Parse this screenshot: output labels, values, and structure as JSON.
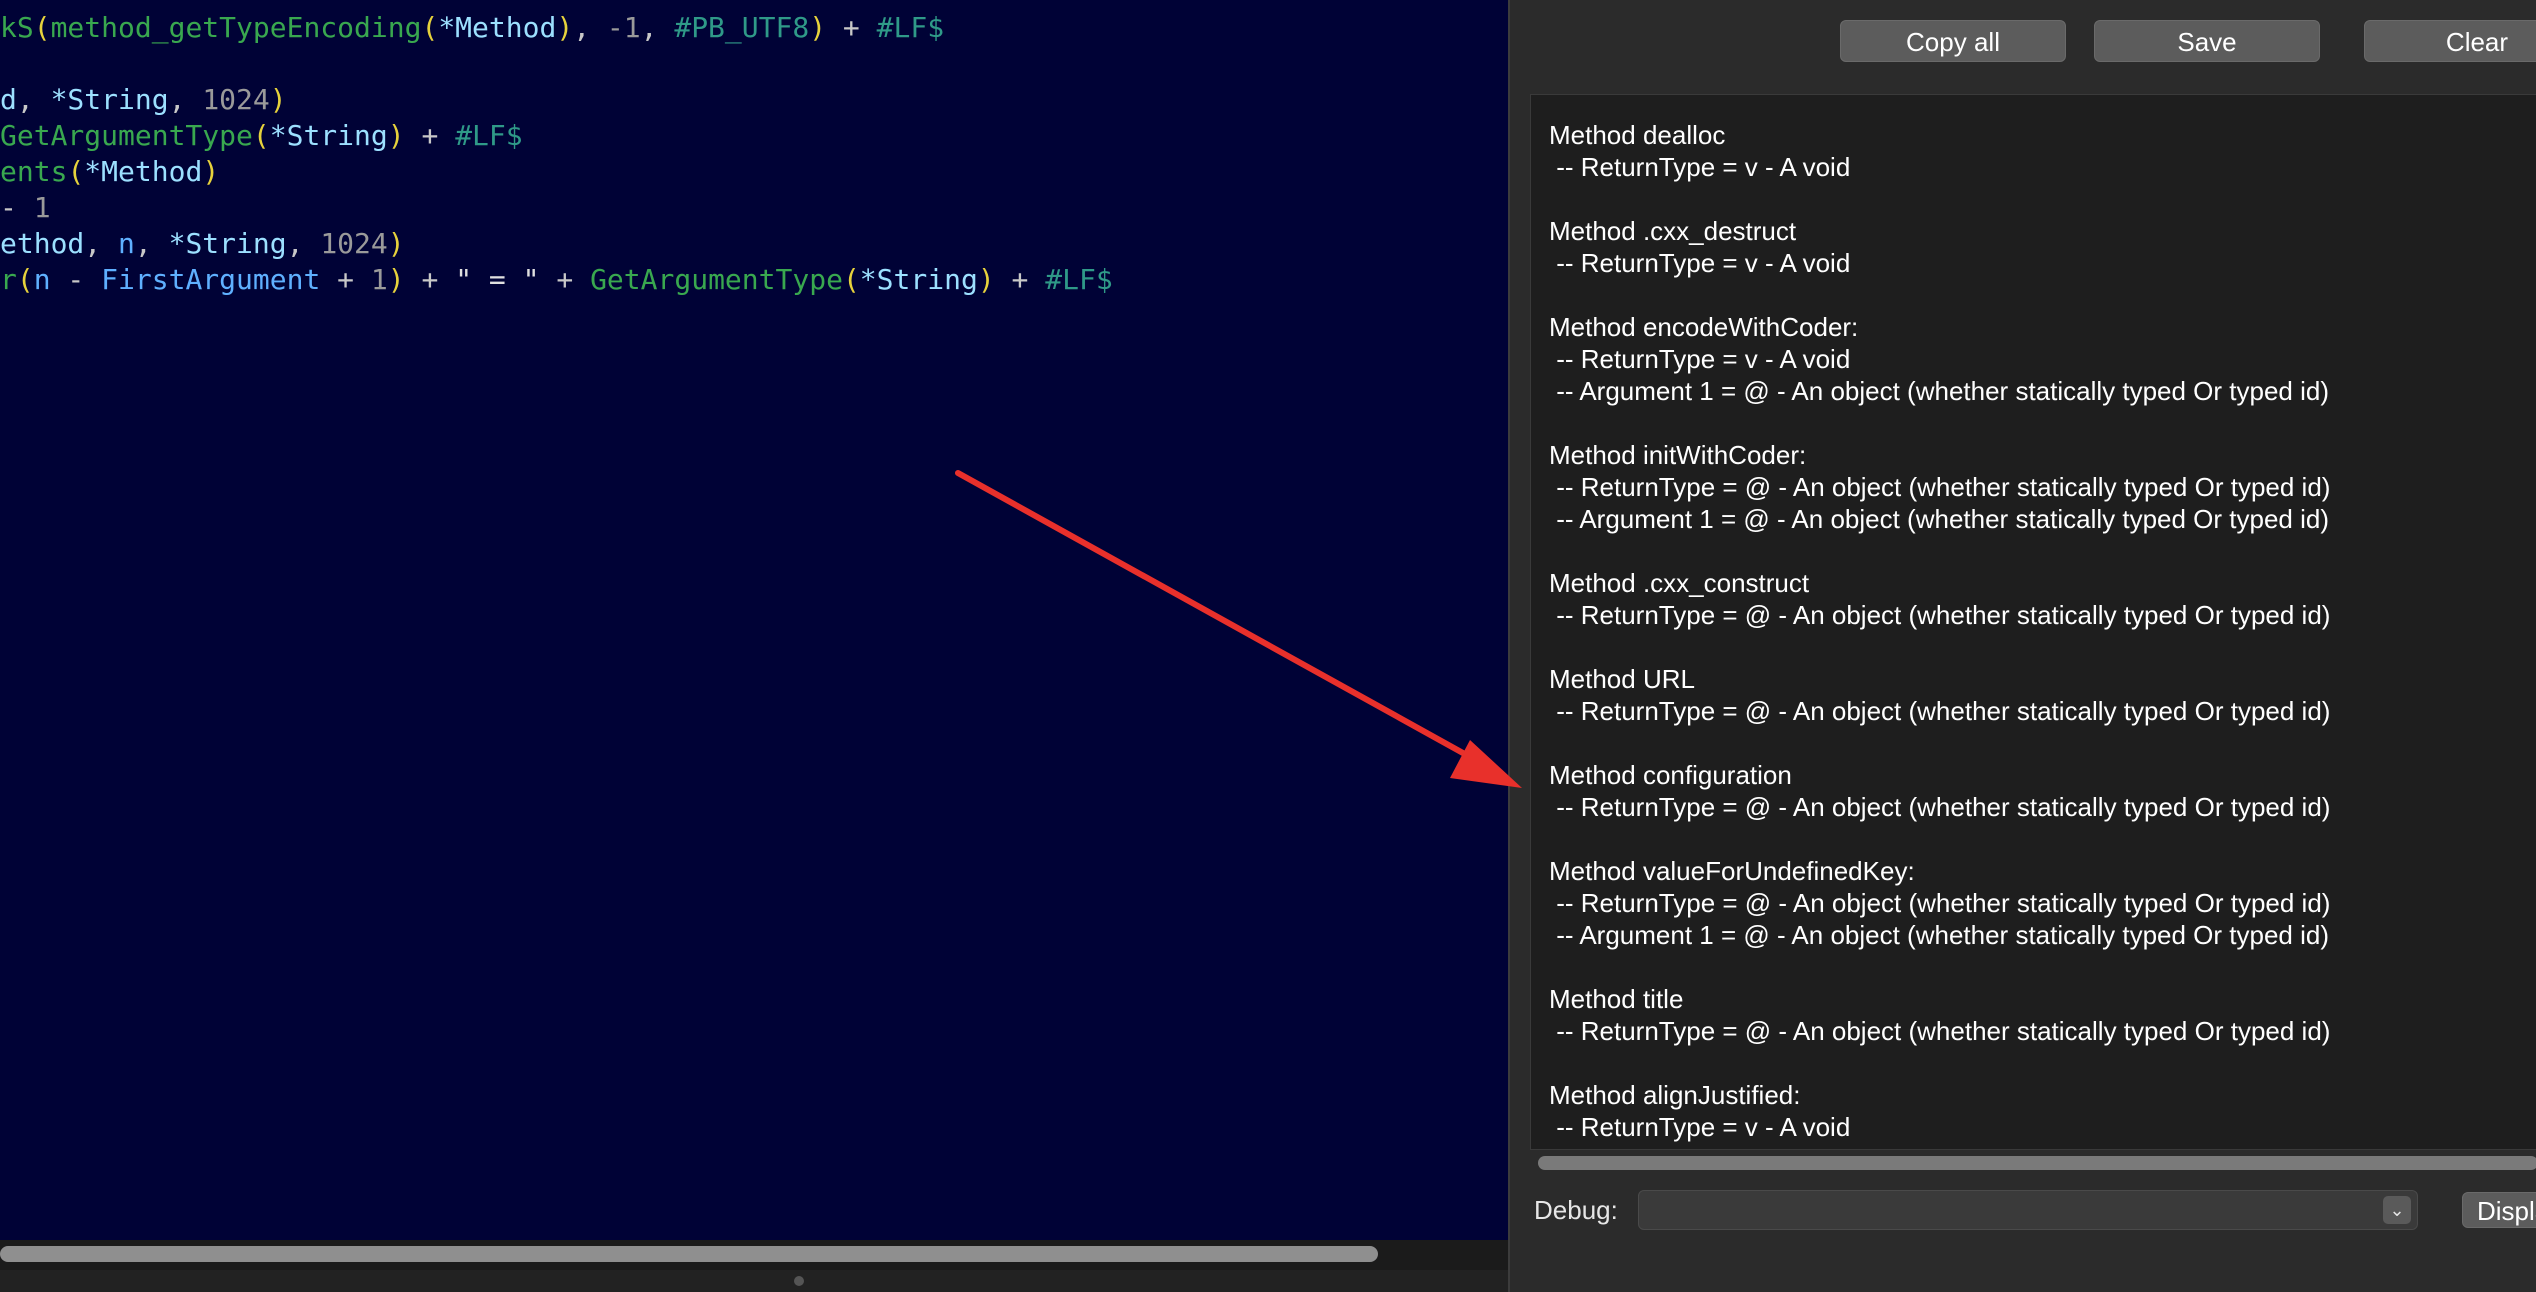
{
  "editor": {
    "lines": [
      [
        {
          "t": "kS",
          "c": "fn"
        },
        {
          "t": "(",
          "c": "par"
        },
        {
          "t": "method_getTypeEncoding",
          "c": "fn"
        },
        {
          "t": "(",
          "c": "par"
        },
        {
          "t": "*Method",
          "c": "var"
        },
        {
          "t": ")",
          "c": "par"
        },
        {
          "t": ", ",
          "c": "pun"
        },
        {
          "t": "-1",
          "c": "num"
        },
        {
          "t": ", ",
          "c": "pun"
        },
        {
          "t": "#PB_UTF8",
          "c": "const"
        },
        {
          "t": ")",
          "c": "par"
        },
        {
          "t": " + ",
          "c": "pun"
        },
        {
          "t": "#LF$",
          "c": "const"
        }
      ],
      [],
      [
        {
          "t": "d",
          "c": "var"
        },
        {
          "t": ", ",
          "c": "pun"
        },
        {
          "t": "*String",
          "c": "var"
        },
        {
          "t": ", ",
          "c": "pun"
        },
        {
          "t": "1024",
          "c": "num"
        },
        {
          "t": ")",
          "c": "par"
        }
      ],
      [
        {
          "t": "GetArgumentType",
          "c": "fn"
        },
        {
          "t": "(",
          "c": "par"
        },
        {
          "t": "*String",
          "c": "var"
        },
        {
          "t": ")",
          "c": "par"
        },
        {
          "t": " + ",
          "c": "pun"
        },
        {
          "t": "#LF$",
          "c": "const"
        }
      ],
      [
        {
          "t": "ents",
          "c": "fn"
        },
        {
          "t": "(",
          "c": "par"
        },
        {
          "t": "*Method",
          "c": "var"
        },
        {
          "t": ")",
          "c": "par"
        }
      ],
      [
        {
          "t": "- ",
          "c": "pun"
        },
        {
          "t": "1",
          "c": "num"
        }
      ],
      [
        {
          "t": "ethod",
          "c": "var"
        },
        {
          "t": ", ",
          "c": "pun"
        },
        {
          "t": "n",
          "c": "kw"
        },
        {
          "t": ", ",
          "c": "pun"
        },
        {
          "t": "*String",
          "c": "var"
        },
        {
          "t": ", ",
          "c": "pun"
        },
        {
          "t": "1024",
          "c": "num"
        },
        {
          "t": ")",
          "c": "par"
        }
      ],
      [
        {
          "t": "r",
          "c": "fn"
        },
        {
          "t": "(",
          "c": "par"
        },
        {
          "t": "n",
          "c": "kw"
        },
        {
          "t": " - ",
          "c": "pun"
        },
        {
          "t": "FirstArgument",
          "c": "kw"
        },
        {
          "t": " + ",
          "c": "pun"
        },
        {
          "t": "1",
          "c": "num"
        },
        {
          "t": ")",
          "c": "par"
        },
        {
          "t": " + ",
          "c": "pun"
        },
        {
          "t": "\" = \"",
          "c": "str"
        },
        {
          "t": " + ",
          "c": "pun"
        },
        {
          "t": "GetArgumentType",
          "c": "fn"
        },
        {
          "t": "(",
          "c": "par"
        },
        {
          "t": "*String",
          "c": "var"
        },
        {
          "t": ")",
          "c": "par"
        },
        {
          "t": " + ",
          "c": "pun"
        },
        {
          "t": "#LF$",
          "c": "const"
        }
      ]
    ],
    "scrollbar_thumb_fraction": 0.914
  },
  "panel": {
    "toolbar": {
      "copy_all_label": "Copy all",
      "save_label": "Save",
      "clear_label": "Clear"
    },
    "log": {
      "blocks": [
        [
          "Method dealloc",
          " -- ReturnType = v - A void"
        ],
        [
          "Method .cxx_destruct",
          " -- ReturnType = v - A void"
        ],
        [
          "Method encodeWithCoder:",
          " -- ReturnType = v - A void",
          " -- Argument 1 = @ - An object (whether statically typed Or typed id)"
        ],
        [
          "Method initWithCoder:",
          " -- ReturnType = @ - An object (whether statically typed Or typed id)",
          " -- Argument 1 = @ - An object (whether statically typed Or typed id)"
        ],
        [
          "Method .cxx_construct",
          " -- ReturnType = @ - An object (whether statically typed Or typed id)"
        ],
        [
          "Method URL",
          " -- ReturnType = @ - An object (whether statically typed Or typed id)"
        ],
        [
          "Method configuration",
          " -- ReturnType = @ - An object (whether statically typed Or typed id)"
        ],
        [
          "Method valueForUndefinedKey:",
          " -- ReturnType = @ - An object (whether statically typed Or typed id)",
          " -- Argument 1 = @ - An object (whether statically typed Or typed id)"
        ],
        [
          "Method title",
          " -- ReturnType = @ - An object (whether statically typed Or typed id)"
        ],
        [
          "Method alignJustified:",
          " -- ReturnType = v - A void"
        ]
      ]
    },
    "debug": {
      "label": "Debug:",
      "selected_value": "",
      "display_button_label": "Display"
    }
  },
  "annotation": {
    "arrow_color": "#e8302b"
  },
  "colors": {
    "editor_background": "#000236",
    "panel_background": "#2b2b2b",
    "log_background": "#1e1e1e"
  },
  "icons": {
    "dropdown": "chevron-down-icon",
    "arrow": "red-arrow-annotation"
  }
}
